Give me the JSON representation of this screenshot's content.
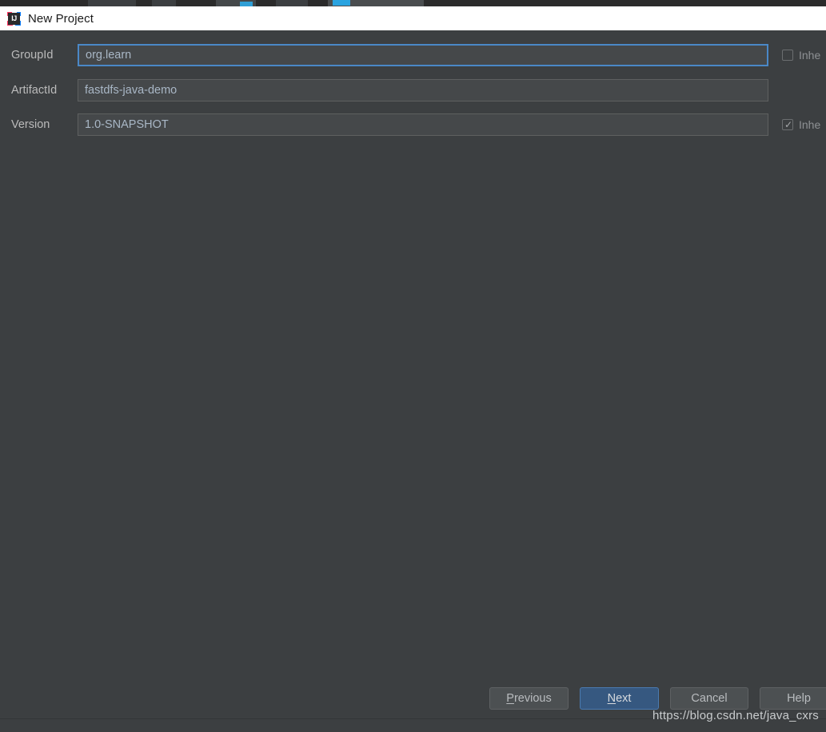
{
  "window": {
    "title": "New Project",
    "app_icon": "intellij-idea-icon"
  },
  "form": {
    "fields": [
      {
        "label": "GroupId",
        "value": "org.learn",
        "placeholder": "",
        "focused": true
      },
      {
        "label": "ArtifactId",
        "value": "fastdfs-java-demo",
        "placeholder": "",
        "focused": false
      },
      {
        "label": "Version",
        "value": "1.0-SNAPSHOT",
        "placeholder": "",
        "focused": false
      }
    ],
    "checkboxes": [
      {
        "label": "Inhe",
        "checked": false
      },
      {
        "label": "Inhe",
        "checked": true
      }
    ]
  },
  "buttons": {
    "previous": {
      "mnemonic": "P",
      "rest": "revious"
    },
    "next": {
      "mnemonic": "N",
      "rest": "ext"
    },
    "cancel": "Cancel",
    "help": "Help"
  },
  "watermark": "https://blog.csdn.net/java_cxrs",
  "colors": {
    "dialog_bg": "#3c3f41",
    "input_bg": "#45484a",
    "input_text": "#a9b7c6",
    "focus_border": "#4a88c7",
    "default_button_bg": "#365880",
    "default_button_border": "#4a7ab0",
    "titlebar_bg": "#ffffff",
    "label_text": "#bbbbbb"
  }
}
